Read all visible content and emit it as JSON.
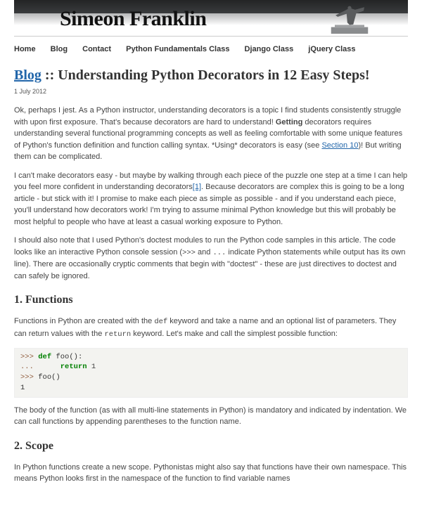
{
  "banner": {
    "title": "Simeon Franklin"
  },
  "nav": {
    "items": [
      {
        "label": "Home"
      },
      {
        "label": "Blog"
      },
      {
        "label": "Contact"
      },
      {
        "label": "Python Fundamentals Class"
      },
      {
        "label": "Django Class"
      },
      {
        "label": "jQuery Class"
      }
    ]
  },
  "post": {
    "crumb": "Blog",
    "sep": " :: ",
    "title": "Understanding Python Decorators in 12 Easy Steps!",
    "date": "1 July 2012",
    "p1a": "Ok, perhaps I jest. As a Python instructor, understanding decorators is a topic I find students consistently struggle with upon first exposure. That's because decorators are hard to understand! ",
    "p1b": "Getting",
    "p1c": " decorators requires understanding several functional programming concepts as well as feeling comfortable with some unique features of Python's function definition and function calling syntax. *Using* decorators is easy (see ",
    "p1_link": "Section 10",
    "p1d": ")! But writing them can be complicated.",
    "p2a": "I can't make decorators easy - but maybe by walking through each piece of the puzzle one step at a time I can help you feel more confident in understanding decorators",
    "p2_link": "[1]",
    "p2b": ". Because decorators are complex this is going to be a long article - but stick with it! I promise to make each piece as simple as possible - and if you understand each piece, you'll understand how decorators work! I'm trying to assume minimal Python knowledge but this will probably be most helpful to people who have at least a casual working exposure to Python.",
    "p3a": "I should also note that I used Python's doctest modules to run the Python code samples in this article. The code looks like an interactive Python console session (",
    "p3_code1": ">>>",
    "p3b": " and ",
    "p3_code2": "...",
    "p3c": " indicate Python statements while output has its own line). There are occasionally cryptic comments that begin with \"doctest\" - these are just directives to doctest and can safely be ignored.",
    "h1": "1. Functions",
    "p4a": "Functions in Python are created with the ",
    "p4_code1": "def",
    "p4b": " keyword and take a name and an optional list of parameters. They can return values with the ",
    "p4_code2": "return",
    "p4c": " keyword. Let's make and call the simplest possible function:",
    "code1": {
      "l1_prompt": ">>> ",
      "l1_kw": "def ",
      "l1_rest": "foo():",
      "l2_prompt": "... ",
      "l2_indent": "     ",
      "l2_kw": "return ",
      "l2_rest": "1",
      "l3_prompt": ">>> ",
      "l3_rest": "foo()",
      "l4": "1"
    },
    "p5": "The body of the function (as with all multi-line statements in Python) is mandatory and indicated by indentation. We can call functions by appending parentheses to the function name.",
    "h2": "2. Scope",
    "p6": "In Python functions create a new scope. Pythonistas might also say that functions have their own namespace. This means Python looks first in the namespace of the function to find variable names"
  }
}
